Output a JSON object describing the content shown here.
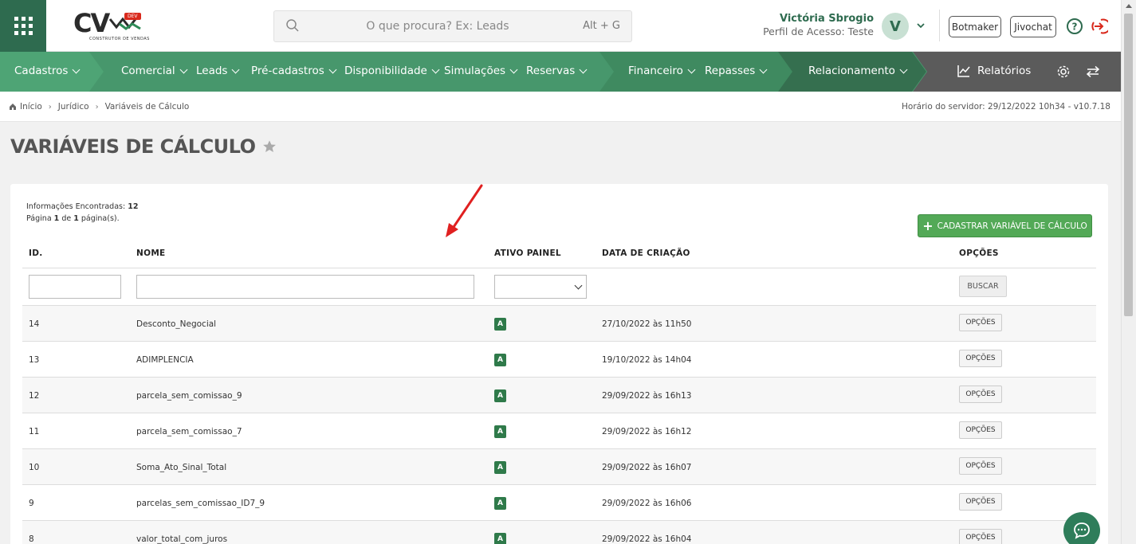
{
  "header": {
    "logo_text": "CV",
    "logo_badge": "DEV",
    "logo_subtitle": "CONSTRUTOR DE VENDAS",
    "search_placeholder": "O que procura? Ex: Leads",
    "search_hotkey": "Alt + G",
    "user_name": "Victória Sbrogio",
    "user_profile": "Perfil de Acesso: Teste",
    "avatar_initial": "V",
    "botmaker_label": "Botmaker",
    "jivochat_label": "Jivochat"
  },
  "nav": {
    "items": [
      {
        "label": "Cadastros"
      },
      {
        "label": "Comercial"
      },
      {
        "label": "Leads"
      },
      {
        "label": "Pré-cadastros"
      },
      {
        "label": "Disponibilidade"
      },
      {
        "label": "Simulações"
      },
      {
        "label": "Reservas"
      },
      {
        "label": "Financeiro"
      },
      {
        "label": "Repasses"
      },
      {
        "label": "Relacionamento"
      }
    ],
    "reports_label": "Relatórios"
  },
  "breadcrumb": {
    "items": [
      "Início",
      "Jurídico",
      "Variáveis de Cálculo"
    ],
    "server_time": "Horário do servidor: 29/12/2022 10h34 - v10.7.18"
  },
  "page": {
    "title": "VARIÁVEIS DE CÁLCULO",
    "info_found_label": "Informações Encontradas:",
    "info_found_count": "12",
    "page_word": "Página",
    "page_current": "1",
    "page_of": "de",
    "page_total": "1",
    "page_suffix": "página(s).",
    "add_button_label": "CADASTRAR VARIÁVEL DE CÁLCULO"
  },
  "table": {
    "headers": {
      "id": "ID.",
      "name": "NOME",
      "active": "ATIVO PAINEL",
      "created": "DATA DE CRIAÇÃO",
      "options": "OPÇÕES"
    },
    "search_button": "BUSCAR",
    "options_button": "OPÇÕES",
    "rows": [
      {
        "id": "14",
        "name": "Desconto_Negocial",
        "active": "A",
        "created": "27/10/2022 às 11h50"
      },
      {
        "id": "13",
        "name": "ADIMPLENCIA",
        "active": "A",
        "created": "19/10/2022 às 14h04"
      },
      {
        "id": "12",
        "name": "parcela_sem_comissao_9",
        "active": "A",
        "created": "29/09/2022 às 16h13"
      },
      {
        "id": "11",
        "name": "parcela_sem_comissao_7",
        "active": "A",
        "created": "29/09/2022 às 16h12"
      },
      {
        "id": "10",
        "name": "Soma_Ato_Sinal_Total",
        "active": "A",
        "created": "29/09/2022 às 16h07"
      },
      {
        "id": "9",
        "name": "parcelas_sem_comissao_ID7_9",
        "active": "A",
        "created": "29/09/2022 às 16h06"
      },
      {
        "id": "8",
        "name": "valor_total_com_juros",
        "active": "A",
        "created": "29/09/2022 às 16h04"
      }
    ]
  },
  "colors": {
    "brand_green": "#2e6b4f",
    "nav_green": "#4a9a6f",
    "button_green": "#53a957",
    "badge_green": "#2f7a4a",
    "exit_red": "#d9291c",
    "annotation_arrow": "#e02020"
  }
}
